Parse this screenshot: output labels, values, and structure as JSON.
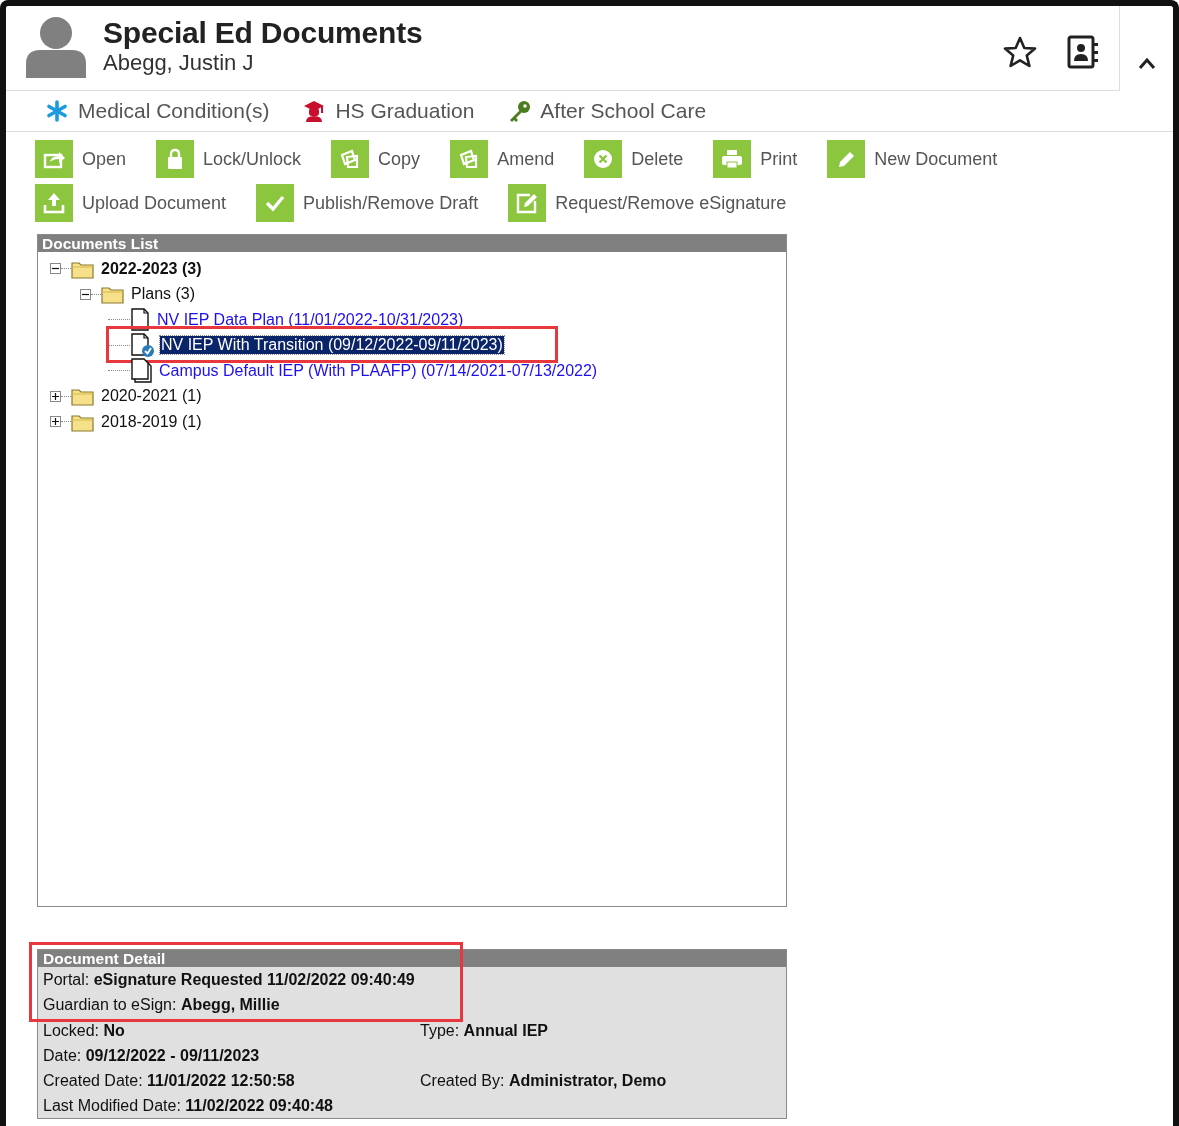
{
  "header": {
    "title": "Special Ed Documents",
    "student": "Abegg, Justin J"
  },
  "flags": [
    {
      "kind": "medical",
      "label": "Medical Condition(s)"
    },
    {
      "kind": "graduation",
      "label": "HS Graduation"
    },
    {
      "kind": "key",
      "label": "After School Care"
    }
  ],
  "toolbar": [
    [
      {
        "kind": "open",
        "label": "Open"
      },
      {
        "kind": "lock",
        "label": "Lock/Unlock"
      },
      {
        "kind": "copy",
        "label": "Copy"
      },
      {
        "kind": "copy",
        "label": "Amend"
      },
      {
        "kind": "delete",
        "label": "Delete"
      },
      {
        "kind": "print",
        "label": "Print"
      },
      {
        "kind": "pencil",
        "label": "New Document"
      }
    ],
    [
      {
        "kind": "upload",
        "label": "Upload Document"
      },
      {
        "kind": "check",
        "label": "Publish/Remove Draft"
      },
      {
        "kind": "edit",
        "label": "Request/Remove eSignature"
      }
    ]
  ],
  "documents_list": {
    "title": "Documents List",
    "tree": [
      {
        "kind": "folder",
        "label": "2022-2023 (3)",
        "current": true,
        "expanded": true,
        "children": [
          {
            "kind": "folder",
            "label": "Plans (3)",
            "current": false,
            "expanded": true,
            "children": [
              {
                "kind": "document",
                "label": "NV IEP Data Plan (11/01/2022-10/31/2023)",
                "selected": false,
                "highlighted": false
              },
              {
                "kind": "esign_document",
                "label": "NV IEP With Transition (09/12/2022-09/11/2023)",
                "selected": true,
                "highlighted": true
              },
              {
                "kind": "stacked_document",
                "label": "Campus Default IEP (With PLAAFP) (07/14/2021-07/13/2022)",
                "selected": false,
                "highlighted": false
              }
            ]
          }
        ]
      },
      {
        "kind": "folder",
        "label": "2020-2021 (1)",
        "current": false,
        "expanded": false
      },
      {
        "kind": "folder",
        "label": "2018-2019 (1)",
        "current": false,
        "expanded": false
      }
    ]
  },
  "document_detail": {
    "title": "Document Detail",
    "rows": [
      {
        "highlighted": true,
        "fields": [
          {
            "label": "Portal:",
            "value": "eSignature Requested 11/02/2022 09:40:49"
          }
        ]
      },
      {
        "highlighted": true,
        "fields": [
          {
            "label": "Guardian to eSign:",
            "value": "Abegg, Millie"
          }
        ]
      },
      {
        "highlighted": false,
        "fields": [
          {
            "label": "Locked:",
            "value": "No"
          },
          {
            "label": "Type:",
            "value": "Annual IEP"
          }
        ]
      },
      {
        "highlighted": false,
        "fields": [
          {
            "label": "Date:",
            "value": "09/12/2022 - 09/11/2023"
          }
        ]
      },
      {
        "highlighted": false,
        "fields": [
          {
            "label": "Created Date:",
            "value": "11/01/2022 12:50:58"
          },
          {
            "label": "Created By:",
            "value": "Administrator, Demo"
          }
        ]
      },
      {
        "highlighted": false,
        "fields": [
          {
            "label": "Last Modified Date:",
            "value": "11/02/2022 09:40:48"
          }
        ]
      }
    ]
  }
}
